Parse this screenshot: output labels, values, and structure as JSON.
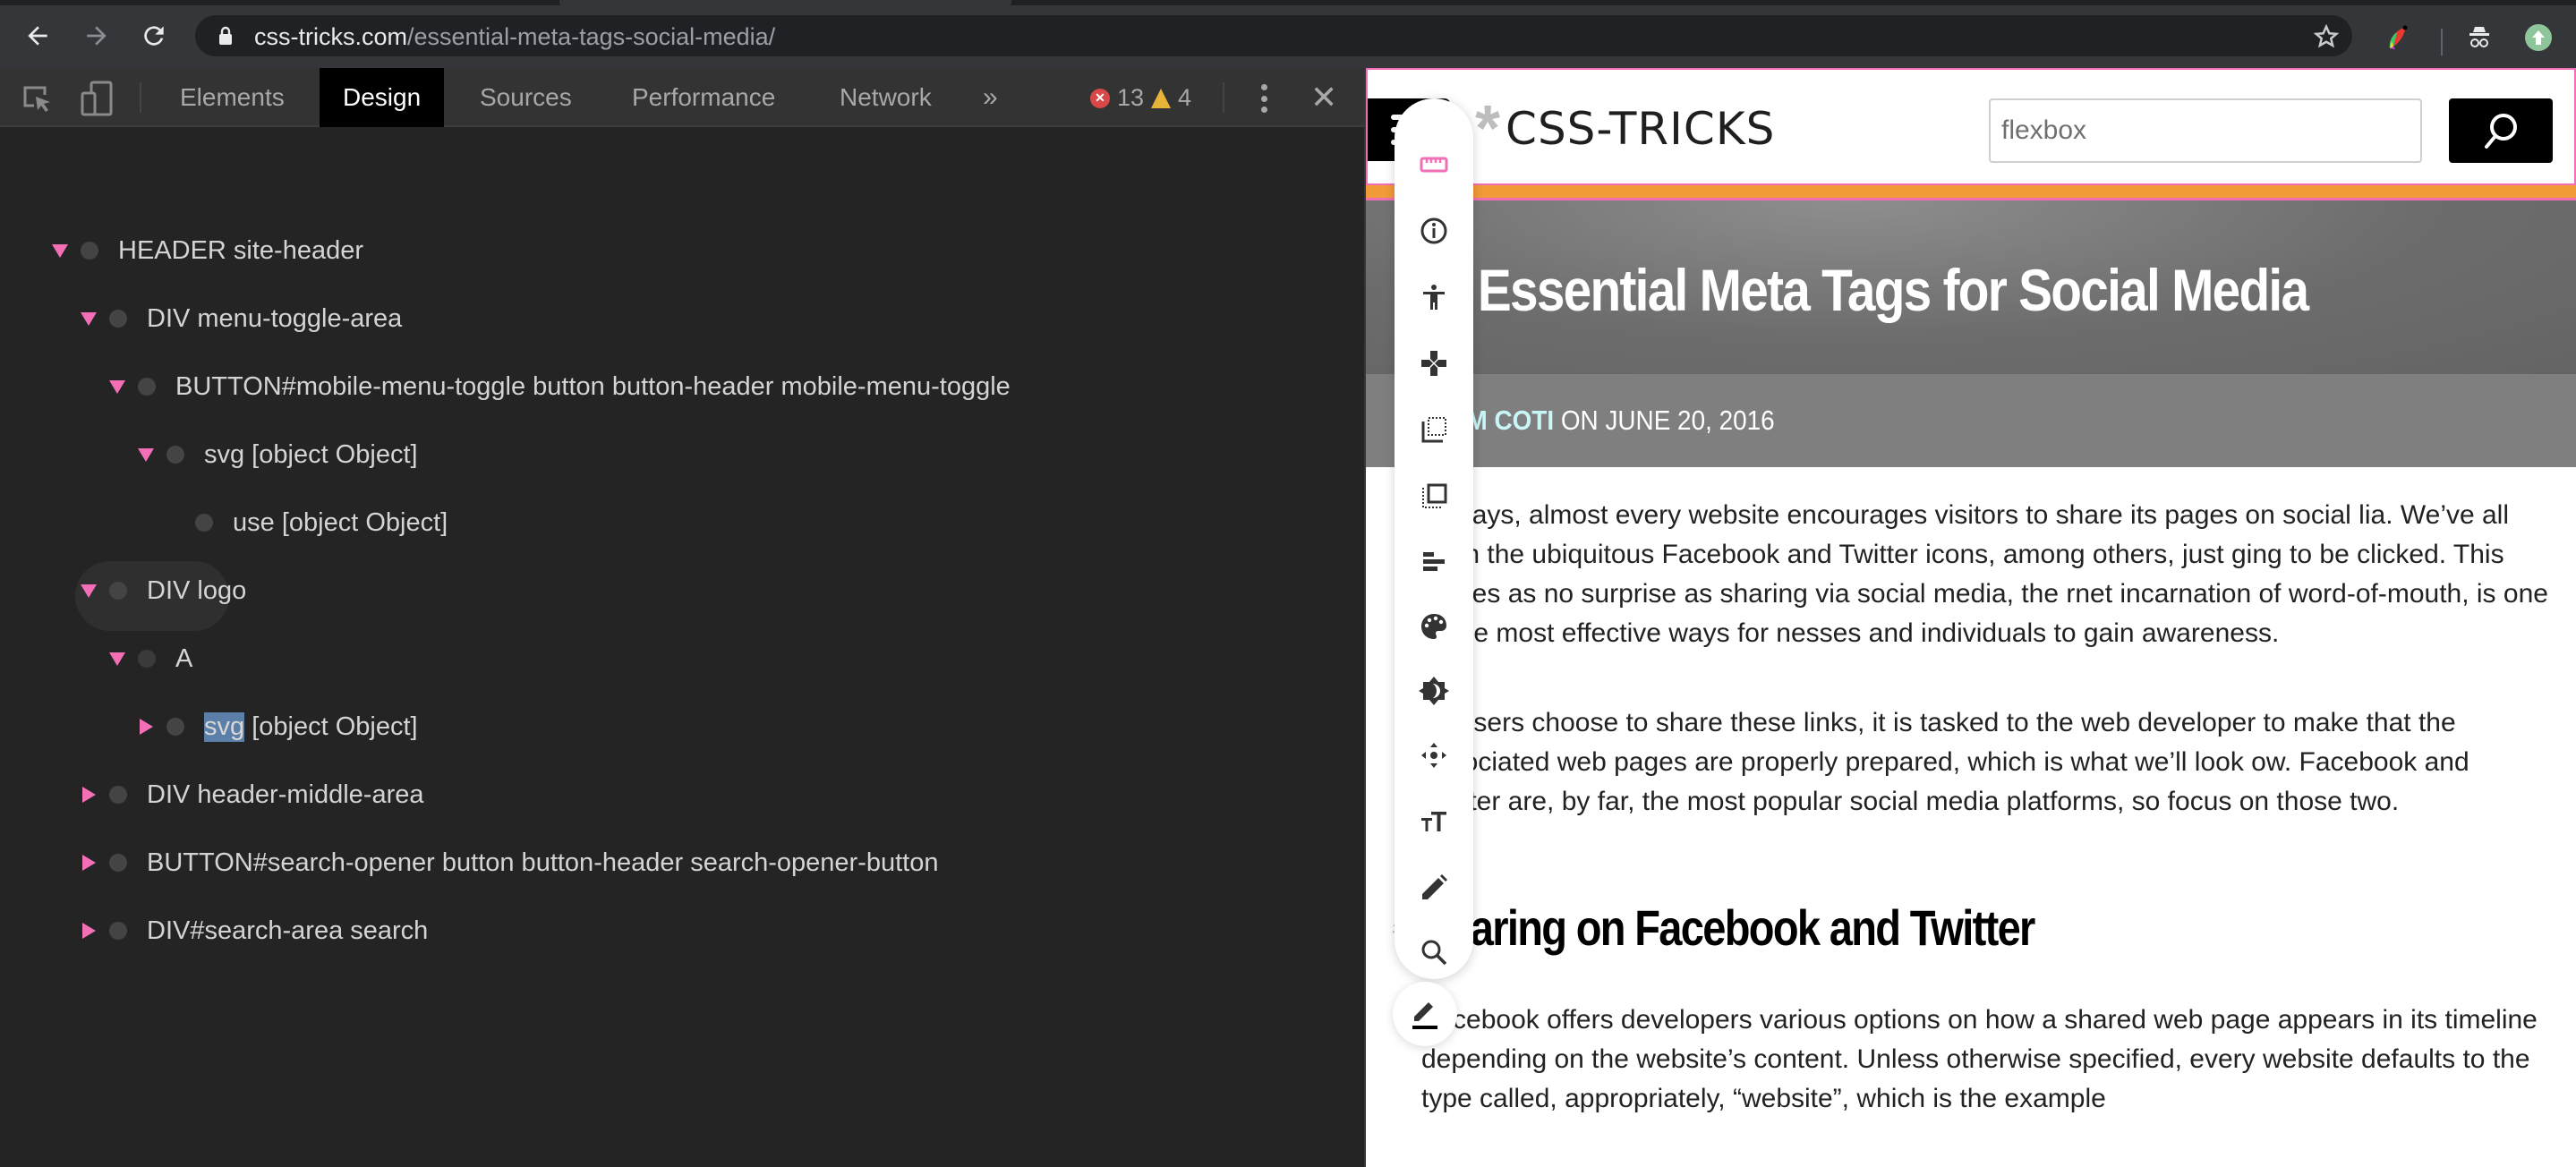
{
  "browser": {
    "url_host": "css-tricks.com",
    "url_path": "/essential-meta-tags-social-media/",
    "icons": [
      "back-arrow-icon",
      "forward-arrow-icon",
      "reload-icon",
      "lock-icon",
      "bookmark-star-icon",
      "extension-feather-icon",
      "incognito-icon",
      "profile-upload-icon"
    ]
  },
  "devtools": {
    "tabs": [
      {
        "label": "Elements",
        "active": false
      },
      {
        "label": "Design",
        "active": true
      },
      {
        "label": "Sources",
        "active": false
      },
      {
        "label": "Performance",
        "active": false
      },
      {
        "label": "Network",
        "active": false
      }
    ],
    "more_tabs": "»",
    "error_count": "13",
    "warning_count": "4",
    "tree": [
      {
        "label": "HEADER site-header",
        "expanded": true,
        "level": 0
      },
      {
        "label": "DIV menu-toggle-area",
        "expanded": true,
        "level": 1
      },
      {
        "label": "BUTTON#mobile-menu-toggle button button-header mobile-menu-toggle",
        "expanded": true,
        "level": 2
      },
      {
        "label": "svg [object Object]",
        "expanded": true,
        "level": 3
      },
      {
        "label": "use [object Object]",
        "expanded": null,
        "level": 4
      },
      {
        "label": "DIV logo",
        "expanded": true,
        "level": 1
      },
      {
        "label": "A",
        "expanded": true,
        "level": 2,
        "hovered": true
      },
      {
        "label_selected": "svg",
        "label_rest": " [object Object]",
        "expanded": false,
        "level": 3
      },
      {
        "label": "DIV header-middle-area",
        "expanded": false,
        "level": 1
      },
      {
        "label": "BUTTON#search-opener button button-header search-opener-button",
        "expanded": false,
        "level": 1
      },
      {
        "label": "DIV#search-area search",
        "expanded": false,
        "level": 1
      }
    ]
  },
  "page": {
    "logo_asterisk": "*",
    "logo_text": "CSS-TRICKS",
    "search_value": "flexbox",
    "title": "The Essential Meta Tags for Social Media",
    "title_visible": "he Essential Meta Tags for Social Media",
    "byline_author": "ADAM COTI",
    "byline_date": " ON JUNE 20, 2016",
    "paragraphs": [
      "se days, almost every website encourages visitors to share its pages on social lia. We’ve all seen the ubiquitous Facebook and Twitter icons, among others, just ging to be clicked. This comes as no surprise as sharing via social media, the rnet incarnation of word-of-mouth, is one of the most effective ways for nesses and individuals to gain awareness.",
      "en users choose to share these links, it is tasked to the web developer to make that the associated web pages are properly prepared, which is what we’ll look ow. Facebook and Twitter are, by far, the most popular social media platforms, so focus on those two."
    ],
    "heading2": "Sharing on Facebook and Twitter",
    "heading2_anchor": "#",
    "paragraph3": "Facebook offers developers various options on how a shared web page appears in its timeline depending on the website’s content. Unless otherwise specified, every website defaults to the type called, appropriately, “website”, which is the example"
  },
  "design_toolbar": {
    "tools": [
      "guides-ruler-icon",
      "info-icon",
      "accessibility-icon",
      "move-gamepad-icon",
      "margin-icon",
      "padding-icon",
      "align-icon",
      "color-palette-icon",
      "brightness-contrast-icon",
      "position-move-icon",
      "font-size-icon",
      "edit-text-icon",
      "search-icon"
    ],
    "active_tool": "guides-ruler-icon",
    "fab": "edit-underline-icon"
  },
  "colors": {
    "accent_pink": "#f26fb5",
    "orange_bar": "#f19a38",
    "author_cyan": "#c9f6f7",
    "error_red": "#d94848",
    "warning_yellow": "#e8b339"
  }
}
